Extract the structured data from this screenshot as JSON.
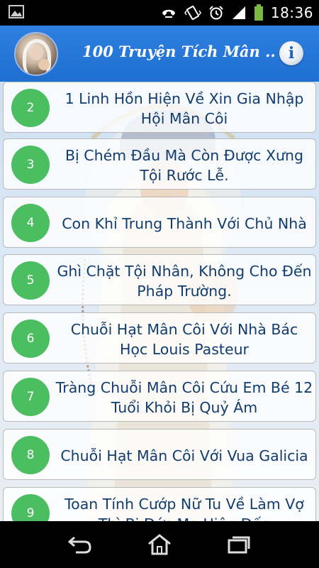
{
  "status_bar": {
    "time": "18:36",
    "icons": [
      "picture-icon",
      "call-forward-icon",
      "vibrate-icon",
      "alarm-icon",
      "signal-icon",
      "battery-icon"
    ]
  },
  "action_bar": {
    "title": "100 Truyện Tích Mân ..",
    "logo": "app-logo-madonna",
    "info_icon": "info-icon"
  },
  "stories": [
    {
      "number": "2",
      "title": "1 Linh Hồn Hiện Về Xin Gia Nhập Hội Mân Côi"
    },
    {
      "number": "3",
      "title": "Bị Chém Đầu Mà Còn Được Xưng Tội Rước Lễ."
    },
    {
      "number": "4",
      "title": "Con Khỉ Trung Thành Với Chủ Nhà"
    },
    {
      "number": "5",
      "title": "Ghì Chặt Tội Nhân, Không Cho Đến Pháp Trường."
    },
    {
      "number": "6",
      "title": "Chuỗi Hạt Mân Côi Với Nhà Bác Học Louis Pasteur"
    },
    {
      "number": "7",
      "title": "Tràng Chuỗi Mân Côi Cứu Em Bé 12 Tuổi Khỏi Bị Quỷ Ám"
    },
    {
      "number": "8",
      "title": "Chuỗi Hạt Mân Côi Với Vua Galicia"
    },
    {
      "number": "9",
      "title": "Toan Tính Cướp Nữ Tu Về Làm Vợ Thì Bị Đức Mẹ Hiện Đến"
    }
  ],
  "colors": {
    "action_bar": "#1f6fd2",
    "number_badge": "#4cbe62",
    "item_text": "#123d6e"
  },
  "nav_bar": {
    "icons": [
      "back-icon",
      "home-icon",
      "recent-apps-icon"
    ]
  }
}
